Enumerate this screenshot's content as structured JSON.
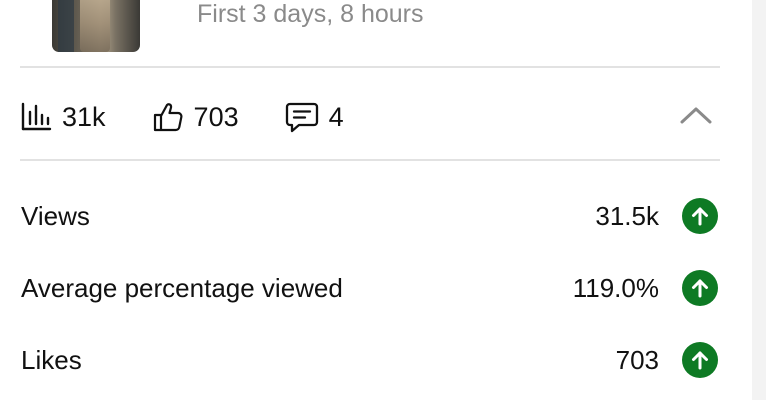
{
  "video": {
    "subtitle": "First 3 days, 8 hours"
  },
  "summary": {
    "views": "31k",
    "likes": "703",
    "comments": "4"
  },
  "metrics": [
    {
      "label": "Views",
      "value": "31.5k",
      "trend": "up"
    },
    {
      "label": "Average percentage viewed",
      "value": "119.0%",
      "trend": "up"
    },
    {
      "label": "Likes",
      "value": "703",
      "trend": "up"
    }
  ],
  "colors": {
    "trend_up": "#0e7a24",
    "subtitle": "#8a8a8a",
    "divider": "#e2e2e2"
  },
  "icons": {
    "views": "bar-chart-icon",
    "likes": "thumbs-up-icon",
    "comments": "comment-icon",
    "collapse": "chevron-up-icon",
    "trend": "arrow-up-circle-icon"
  }
}
